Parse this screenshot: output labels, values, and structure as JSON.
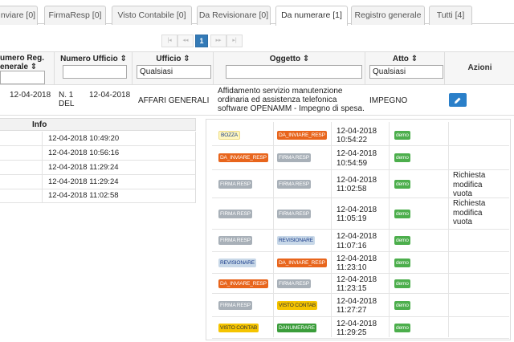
{
  "tabs": [
    {
      "label": "nviare [0]",
      "active": false
    },
    {
      "label": "FirmaResp [0]",
      "active": false
    },
    {
      "label": "Visto Contabile [0]",
      "active": false
    },
    {
      "label": "Da Revisionare [0]",
      "active": false
    },
    {
      "label": "Da numerare [1]",
      "active": true
    },
    {
      "label": "Registro generale",
      "active": false
    },
    {
      "label": "Tutti [4]",
      "active": false
    }
  ],
  "pager": {
    "first": "|◂",
    "prev": "◂◂",
    "current": "1",
    "next": "▸▸",
    "last": "▸|"
  },
  "columns": {
    "num_reg_line1": "umero Reg.",
    "num_reg_line2": "enerale ⇕",
    "num_ufficio": "Numero Ufficio ⇕",
    "ufficio": "Ufficio ⇕",
    "oggetto": "Oggetto ⇕",
    "atto": "Atto ⇕",
    "azioni": "Azioni"
  },
  "filters": {
    "ufficio_value": "Qualsiasi",
    "atto_value": "Qualsiasi",
    "oggetto_value": "",
    "num_ufficio_value": "",
    "num_reg_value": ""
  },
  "row": {
    "data_reg": "12-04-2018",
    "num_ufficio_line1": "N. 1",
    "num_ufficio_line2": "DEL",
    "data_ufficio": "12-04-2018",
    "ufficio": "AFFARI GENERALI",
    "oggetto_l1": "Affidamento servizio manutenzione",
    "oggetto_l2": "ordinaria ed assistenza telefonica",
    "oggetto_l3": "software OPENAMM - Impegno di spesa.",
    "atto": "IMPEGNO"
  },
  "info": {
    "header": "Info",
    "rows": [
      "12-04-2018 10:49:20",
      "12-04-2018 10:56:16",
      "12-04-2018 11:29:24",
      "12-04-2018 11:29:24",
      "12-04-2018 11:02:58"
    ]
  },
  "history": [
    {
      "from": "BOZZA",
      "to": "DA_INVIARE_RESP",
      "date": "12-04-2018",
      "time": "10:54:22",
      "user": "demo",
      "note1": "",
      "note2": "",
      "note3": ""
    },
    {
      "from": "DA_INVIARE_RESP",
      "to": "FIRMA RESP",
      "date": "12-04-2018",
      "time": "10:54:59",
      "user": "demo",
      "note1": "",
      "note2": "",
      "note3": ""
    },
    {
      "from": "FIRMA RESP",
      "to": "FIRMA RESP",
      "date": "12-04-2018",
      "time": "11:02:58",
      "user": "demo",
      "note1": "Richiesta",
      "note2": "modifica",
      "note3": "vuota"
    },
    {
      "from": "FIRMA RESP",
      "to": "FIRMA RESP",
      "date": "12-04-2018",
      "time": "11:05:19",
      "user": "demo",
      "note1": "Richiesta",
      "note2": "modifica",
      "note3": "vuota"
    },
    {
      "from": "FIRMA RESP",
      "to": "REVISIONARE",
      "date": "12-04-2018",
      "time": "11:07:16",
      "user": "demo",
      "note1": "",
      "note2": "",
      "note3": ""
    },
    {
      "from": "REVISIONARE",
      "to": "DA_INVIARE_RESP",
      "date": "12-04-2018",
      "time": "11:23:10",
      "user": "demo",
      "note1": "",
      "note2": "",
      "note3": ""
    },
    {
      "from": "DA_INVIARE_RESP",
      "to": "FIRMA RESP",
      "date": "12-04-2018",
      "time": "11:23:15",
      "user": "demo",
      "note1": "",
      "note2": "",
      "note3": ""
    },
    {
      "from": "FIRMA RESP",
      "to": "VISTO CONTAB",
      "date": "12-04-2018",
      "time": "11:27:27",
      "user": "demo",
      "note1": "",
      "note2": "",
      "note3": ""
    },
    {
      "from": "VISTO CONTAB",
      "to": "DANUMERARE",
      "date": "12-04-2018",
      "time": "11:29:25",
      "user": "demo",
      "note1": "",
      "note2": "",
      "note3": ""
    }
  ],
  "colors": {
    "accent": "#2a7fc9",
    "pager_current": "#337ab7",
    "status_dainviare": "#e8651c",
    "status_firma": "#a8b0b8",
    "status_visto": "#f5c400",
    "status_danumerare": "#3a9d3a",
    "status_demo": "#4cae4c"
  },
  "icons": {
    "edit": "pencil-icon"
  }
}
